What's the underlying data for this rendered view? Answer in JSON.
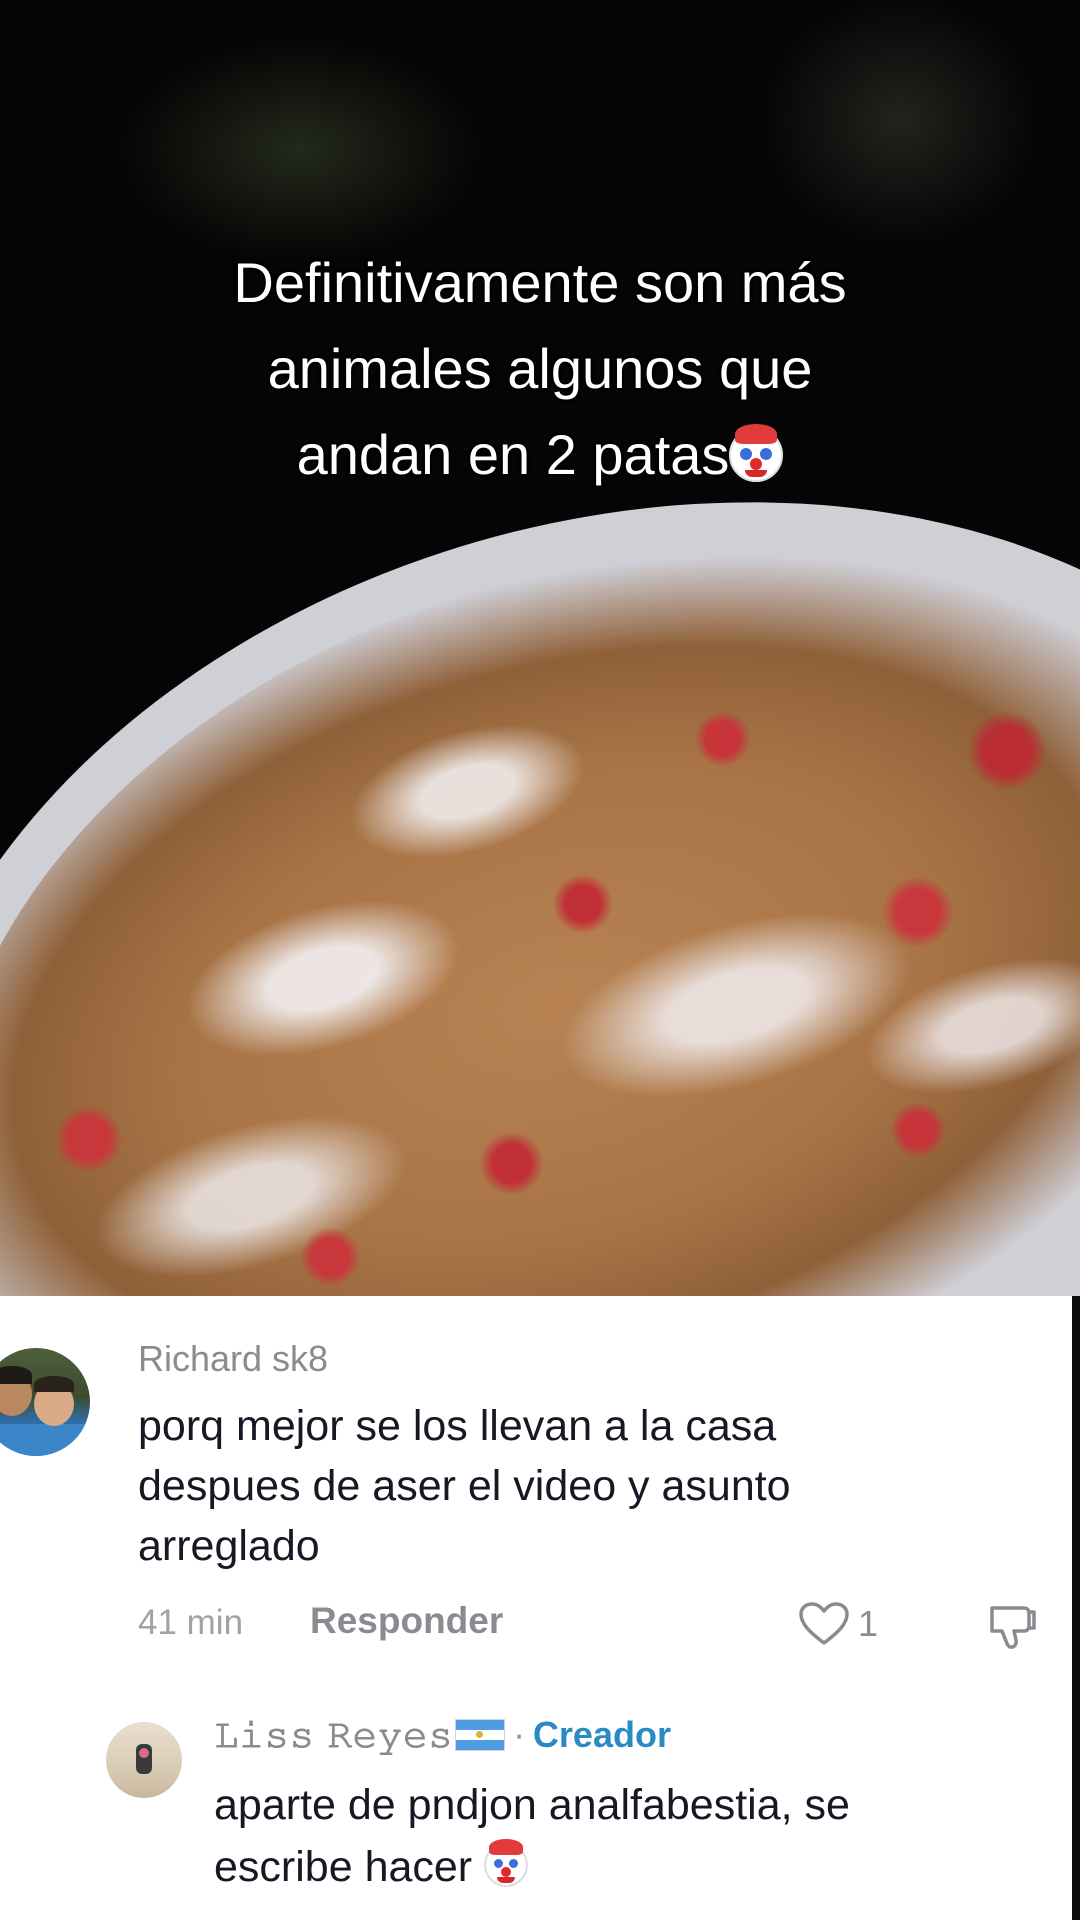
{
  "video": {
    "caption_lines": [
      "Definitivamente son más",
      "animales algunos que",
      "andan en 2 patas"
    ],
    "caption_emoji": "clown-face-icon"
  },
  "comment": {
    "username": "Richard sk8",
    "text_lines": [
      "porq mejor se los llevan a la casa",
      "despues de aser el video y asunto",
      "arreglado"
    ],
    "time": "41 min",
    "reply_label": "Responder",
    "like_count": "1"
  },
  "reply": {
    "username": "𝙻𝚒𝚜𝚜 𝚁𝚎𝚢𝚎𝚜",
    "flag": "el-salvador-flag-icon",
    "separator": "·",
    "creator_badge": "Creador",
    "text_lines": [
      "aparte de pndjon analfabestia, se",
      "escribe hacer"
    ],
    "text_emoji": "clown-face-icon"
  },
  "colors": {
    "panel_background": "#ffffff",
    "username_gray": "#8a8b91",
    "text_dark": "#161823",
    "creator_blue": "#2b8ac4"
  }
}
